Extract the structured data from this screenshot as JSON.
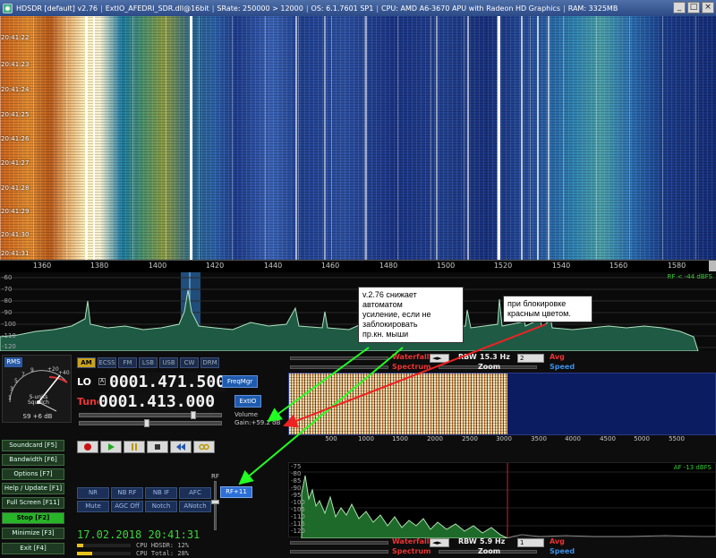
{
  "titlebar": {
    "title": "HDSDR [default]  v2.76",
    "extio": "ExtIO_AFEDRI_SDR.dll@16bit",
    "srate": "SRate: 250000 > 12000",
    "os": "OS: 6.1.7601 SP1",
    "cpu": "CPU: AMD A6-3670 APU with Radeon HD Graphics",
    "ram": "RAM: 3325MB"
  },
  "waterfall": {
    "times": [
      "20:41:22",
      "20:41:23",
      "20:41:24",
      "20:41:25",
      "20:41:26",
      "20:41:27",
      "20:41:28",
      "20:41:29",
      "20:41:30",
      "20:41:31"
    ],
    "freq_ticks": [
      "1360",
      "1380",
      "1400",
      "1420",
      "1440",
      "1460",
      "1480",
      "1500",
      "1520",
      "1540",
      "1560",
      "1580"
    ]
  },
  "spectrum": {
    "db_ticks": [
      "-60",
      "-70",
      "-80",
      "-90",
      "-100",
      "-110",
      "-120"
    ],
    "rf_level": "RF < -44 dBFS"
  },
  "smeter": {
    "rms": "RMS",
    "reading": "S9 +6 dB",
    "squelch_l1": "S-units",
    "squelch_l2": "Squelch",
    "scale": [
      "1",
      "3",
      "5",
      "7",
      "9",
      "+20",
      "+40"
    ]
  },
  "modes": [
    "AM",
    "ECSS",
    "FM",
    "LSB",
    "USB",
    "CW",
    "DRM"
  ],
  "selected_mode": "AM",
  "vfo": {
    "lo_label": "LO",
    "lo_box": "A",
    "lo_freq": "0001.471.500",
    "tune_label": "Tune",
    "tune_freq": "0001.413.000"
  },
  "buttons": {
    "freqmgr": "FreqMgr",
    "extio": "ExtIO",
    "volume_label": "Volume",
    "gain_label": "Gain:+59.2 dB"
  },
  "commands": [
    {
      "label": "Soundcard  [F5]"
    },
    {
      "label": "Bandwidth  [F6]"
    },
    {
      "label": "Options   [F7]"
    },
    {
      "label": "Help / Update  [F1]"
    },
    {
      "label": "Full Screen  [F11]"
    },
    {
      "label": "Stop      [F2]",
      "active": true
    },
    {
      "label": "Minimize  [F3]"
    },
    {
      "label": "Exit      [F4]"
    }
  ],
  "dsp": {
    "row1": [
      "NR",
      "NB RF",
      "NB IF",
      "AFC"
    ],
    "row2": [
      "Mute",
      "AGC Off",
      "Notch",
      "ANotch"
    ],
    "rf_label": "RF",
    "rf_button": "RF+11"
  },
  "clock": "17.02.2018 20:41:31",
  "cpu": {
    "hdsdr_label": "CPU HDSDR:",
    "hdsdr_value": "12%",
    "hdsdr_fraction": 0.12,
    "total_label": "CPU Total:",
    "total_value": "28%",
    "total_fraction": 0.28
  },
  "rf_controls": {
    "waterfall": "Waterfall",
    "spectrum": "Spectrum",
    "zoom": "Zoom",
    "rbw": "RBW",
    "rbw_value": "15.3 Hz",
    "avg": "Avg",
    "speed": "Speed",
    "avg_value": "2"
  },
  "wf2_axis": [
    "500",
    "1000",
    "1500",
    "2000",
    "2500",
    "3000",
    "3500",
    "4000",
    "4500",
    "5000",
    "5500"
  ],
  "af_controls": {
    "waterfall": "Waterfall",
    "spectrum": "Spectrum",
    "zoom": "Zoom",
    "rbw": "RBW",
    "rbw_value": "5.9 Hz",
    "avg": "Avg",
    "speed": "Speed",
    "avg_value": "1",
    "af_level": "AF -13 dBFS"
  },
  "audio_db_ticks": [
    "-75",
    "-80",
    "-85",
    "-90",
    "-95",
    "-100",
    "-105",
    "-110",
    "-115",
    "-120"
  ],
  "annotations": {
    "note1_l1": "v.2.76 снижает",
    "note1_l2": "автоматом",
    "note1_l3": "усиление, если не",
    "note1_l4": "заблокировать",
    "note1_l5": "пр.кн. мыши",
    "note2_l1": "при блокировке",
    "note2_l2": "красным цветом."
  },
  "colors": {
    "accent_green": "#3cd33c",
    "tune_red": "#e33333",
    "waterfall_label_red": "#e33333",
    "speed_blue": "#3b8fe8",
    "mode_selected": "#c9a21d"
  }
}
